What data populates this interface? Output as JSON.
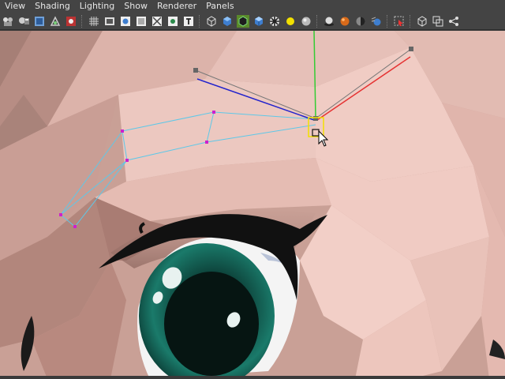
{
  "menu": [
    "View",
    "Shading",
    "Lighting",
    "Show",
    "Renderer",
    "Panels"
  ],
  "toolbar": {
    "icons": [
      "camera-attributes-icon",
      "bookmark-icon",
      "image-plane-icon",
      "2d-pan-zoom-icon",
      "grease-pencil-icon",
      "separator",
      "grid-icon",
      "film-gate-icon",
      "resolution-gate-icon",
      "gate-mask-icon",
      "field-chart-icon",
      "safe-action-icon",
      "safe-title-icon",
      "separator",
      "wireframe-icon",
      "smooth-shade-icon",
      "wireframe-on-shaded-icon",
      "flat-shade-icon",
      "textured-icon",
      "default-light-icon",
      "all-lights-icon",
      "separator",
      "shadows-icon",
      "ambient-occlusion-icon",
      "anti-alias-icon",
      "motion-blur-icon",
      "separator",
      "isolate-select-icon",
      "separator",
      "xray-icon",
      "xray-joints-icon",
      "xray-components-icon"
    ]
  },
  "colors": {
    "skin": "#e9c7bf",
    "skin_shadow": "#c89a90",
    "wire_blue": "#5ec8e8",
    "axis_x": "#e53333",
    "axis_y": "#33cc33",
    "axis_z": "#2222cc",
    "iris": "#0e5c4c",
    "highlight": "#f2e000"
  }
}
